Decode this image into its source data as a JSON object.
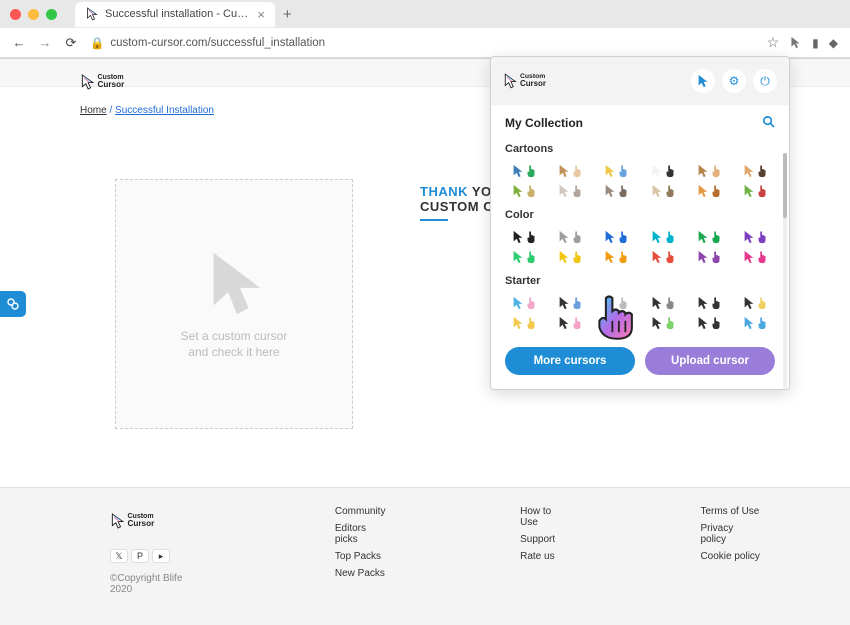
{
  "browser": {
    "tab_title": "Successful installation - Custom",
    "url": "custom-cursor.com/successful_installation"
  },
  "page": {
    "breadcrumb": {
      "home": "Home",
      "sep": "/",
      "current": "Successful Installation"
    },
    "demo_text_line1": "Set a custom cursor",
    "demo_text_line2": "and check it here",
    "thank_pre": "THANK",
    "thank_rest": " YOU",
    "thank_line2": "CUSTOM CU"
  },
  "footer": {
    "copyright": "©Copyright Blife 2020",
    "col1": [
      "Community",
      "Editors picks",
      "Top Packs",
      "New Packs"
    ],
    "col2": [
      "How to Use",
      "Support",
      "Rate us"
    ],
    "col3": [
      "Terms of Use",
      "Privacy policy",
      "Cookie policy"
    ]
  },
  "popup": {
    "my_collection": "My Collection",
    "more_btn": "More cursors",
    "upload_btn": "Upload cursor",
    "sections": [
      {
        "label": "Cartoons",
        "rows": [
          [
            [
              "#3d7db8",
              "#2aa85c"
            ],
            [
              "#c08f5a",
              "#e6c9a3"
            ],
            [
              "#efc84a",
              "#6aa2e0"
            ],
            [
              "#f2f2f2",
              "#333"
            ],
            [
              "#b6834b",
              "#e3b07a"
            ],
            [
              "#e0a66a",
              "#5a4030"
            ]
          ],
          [
            [
              "#7db13e",
              "#c8b06a"
            ],
            [
              "#d1c5c0",
              "#b0a49c"
            ],
            [
              "#9a897d",
              "#7b6c61"
            ],
            [
              "#d8c6a6",
              "#8f7a5e"
            ],
            [
              "#e39a45",
              "#b86d2c"
            ],
            [
              "#6fb348",
              "#c94242"
            ]
          ]
        ]
      },
      {
        "label": "Color",
        "rows": [
          [
            [
              "#222",
              "#222"
            ],
            [
              "#9e9e9e",
              "#9e9e9e"
            ],
            [
              "#1f6cd6",
              "#1f6cd6"
            ],
            [
              "#00b4cc",
              "#00b4cc"
            ],
            [
              "#1aa952",
              "#1aa952"
            ],
            [
              "#7b3fbf",
              "#7b3fbf"
            ]
          ],
          [
            [
              "#2ecc71",
              "#2ecc71"
            ],
            [
              "#f1c40f",
              "#f1c40f"
            ],
            [
              "#f39c12",
              "#f39c12"
            ],
            [
              "#e74c3c",
              "#e74c3c"
            ],
            [
              "#8e44ad",
              "#8e44ad"
            ],
            [
              "#e6398c",
              "#e6398c"
            ]
          ]
        ]
      },
      {
        "label": "Starter",
        "rows": [
          [
            [
              "#4fb2e6",
              "#f3a8c7"
            ],
            [
              "#333",
              "#6a9fdc"
            ],
            [
              "#bbb",
              "#bbb"
            ],
            [
              "#333",
              "#888"
            ],
            [
              "#333",
              "#333"
            ],
            [
              "#333",
              "#f0d060"
            ]
          ],
          [
            [
              "#f2c94c",
              "#f2c94c"
            ],
            [
              "#333",
              "#f5a3c7"
            ],
            [
              "#7b4fc2",
              "#333"
            ],
            [
              "#333",
              "#7bd06a"
            ],
            [
              "#333",
              "#333"
            ],
            [
              "#4aa8e0",
              "#4aa8e0"
            ]
          ]
        ]
      }
    ]
  }
}
